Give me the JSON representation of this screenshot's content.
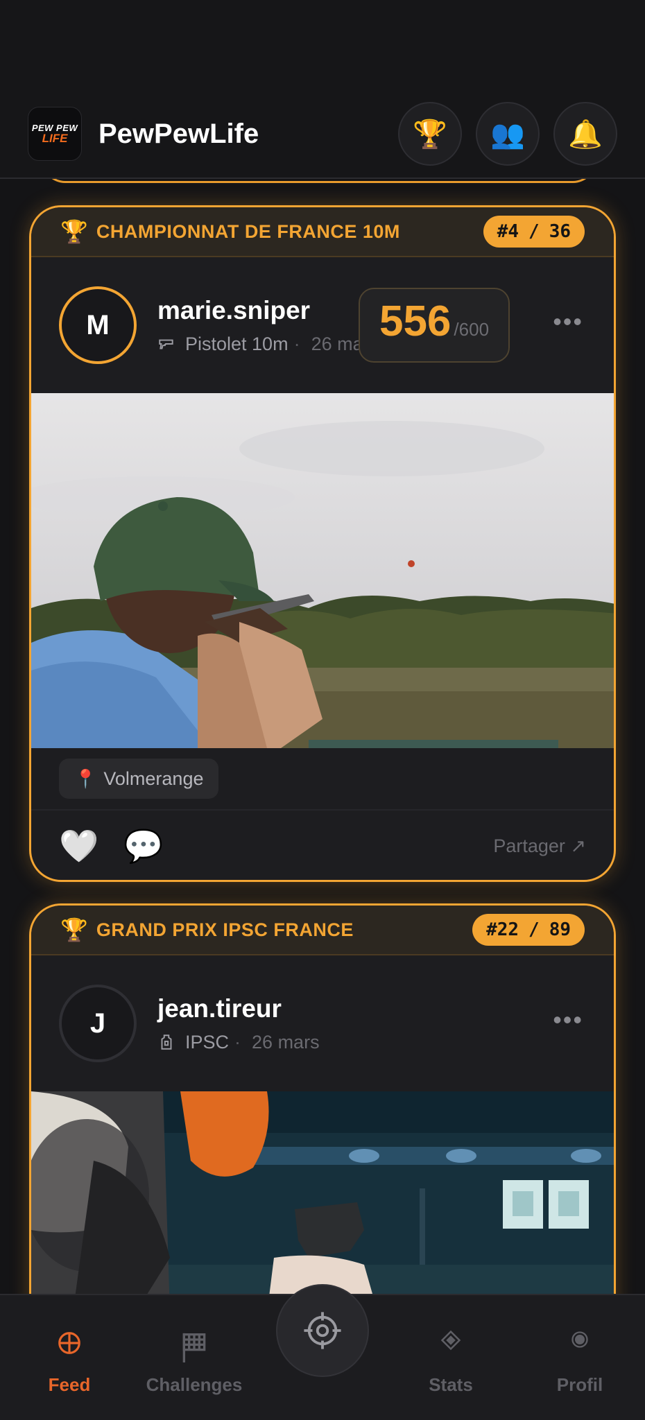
{
  "header": {
    "logo_top": "PEW PEW",
    "logo_bottom": "LIFE",
    "title": "PewPewLife",
    "buttons": [
      {
        "icon": "trophy-icon",
        "glyph": "🏆"
      },
      {
        "icon": "users-icon",
        "glyph": "👥"
      },
      {
        "icon": "bell-icon",
        "glyph": "🔔"
      }
    ]
  },
  "posts": [
    {
      "event": {
        "trophy": "🏆",
        "name": "CHAMPIONNAT DE FRANCE 10M",
        "rank": "#4",
        "sep": "/",
        "total": "36"
      },
      "user": {
        "initial": "M",
        "username": "marie.sniper",
        "discipline": "Pistolet 10m",
        "dot": "·",
        "date": "26 mars"
      },
      "score": {
        "value": "556",
        "max": "/600"
      },
      "more": "•••",
      "location": {
        "pin": "📍",
        "name": "Volmerange"
      },
      "actions": {
        "like": "🤍",
        "comment": "💬",
        "share": "Partager ↗"
      }
    },
    {
      "event": {
        "trophy": "🏆",
        "name": "GRAND PRIX IPSC FRANCE",
        "rank": "#22",
        "sep": "/",
        "total": "89"
      },
      "user": {
        "initial": "J",
        "username": "jean.tireur",
        "discipline": "IPSC",
        "dot": "·",
        "date": "26 mars"
      },
      "more": "•••"
    }
  ],
  "tabs": [
    {
      "label": "Feed",
      "icon": "crosshair-icon",
      "active": true
    },
    {
      "label": "Challenges",
      "icon": "flag-icon",
      "active": false
    },
    {
      "label": "",
      "icon": "target-icon",
      "active": false
    },
    {
      "label": "Stats",
      "icon": "diamond-icon",
      "active": false
    },
    {
      "label": "Profil",
      "icon": "profile-dot-icon",
      "active": false
    }
  ],
  "colors": {
    "accent": "#f3a533",
    "active_tab": "#e8662a",
    "background": "#141416"
  }
}
